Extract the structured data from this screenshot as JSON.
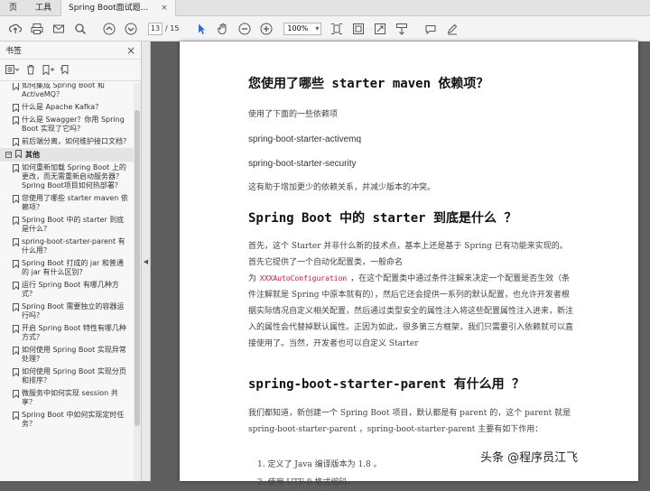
{
  "tabs": {
    "tools": "工具",
    "doc": "Spring Boot面试题...",
    "close": "×",
    "left_stub": "页"
  },
  "toolbar": {
    "page_current": "13",
    "page_total": "/ 15",
    "zoom": "100%"
  },
  "sidebar": {
    "title": "书签",
    "close": "×",
    "items_before": [
      {
        "label": "如何集成 Spring Boot 和 ActiveMQ？"
      },
      {
        "label": "什么是 Apache Kafka？"
      },
      {
        "label": "什么是 Swagger？你用 Spring Boot 实现了它吗？"
      },
      {
        "label": "前后端分离，如何维护接口文档？"
      }
    ],
    "group": {
      "label": "其他",
      "toggle": "−"
    },
    "items_after": [
      {
        "label": "如何重新加载 Spring Boot 上的更改，而无需重新启动服务器？Spring Boot项目如何热部署？"
      },
      {
        "label": "您使用了哪些 starter maven 依赖项？"
      },
      {
        "label": "Spring Boot 中的 starter 到底是什么？"
      },
      {
        "label": "spring-boot-starter-parent 有什么用？"
      },
      {
        "label": "Spring Boot 打成的 jar 和普通的 jar 有什么区别？"
      },
      {
        "label": "运行 Spring Boot 有哪几种方式？"
      },
      {
        "label": "Spring Boot 需要独立的容器运行吗？"
      },
      {
        "label": "开启 Spring Boot 特性有哪几种方式？"
      },
      {
        "label": "如何使用 Spring Boot 实现异常处理？"
      },
      {
        "label": "如何使用 Spring Boot 实现分页和排序？"
      },
      {
        "label": "微服务中如何实现 session 共享？"
      },
      {
        "label": "Spring Boot 中如何实现定时任务？"
      }
    ]
  },
  "doc": {
    "h1": "您使用了哪些 starter maven 依赖项？",
    "p1": "使用了下面的一些依赖项",
    "dep1": "spring-boot-starter-activemq",
    "dep2": "spring-boot-starter-security",
    "p2": "这有助于增加更少的依赖关系，并减少版本的冲突。",
    "h2": "Spring Boot 中的 starter 到底是什么 ？",
    "p3a": "首先，这个 Starter 并非什么新的技术点，基本上还是基于 Spring 已有功能来实现的。首先它提供了一个自动化配置类，一般命名",
    "p3b_pre": "为 ",
    "p3b_code": "XXXAutoConfiguration",
    "p3b_post": " ，在这个配置类中通过条件注解来决定一个配置是否生效（条件注解就是 Spring 中原本就有的），然后它还会提供一系列的默认配置，也允许开发者根据实际情况自定义相关配置，然后通过类型安全的属性注入将这些配置属性注入进来，新注入的属性会代替掉默认属性。正因为如此，很多第三方框架，我们只需要引入依赖就可以直接使用了。当然，开发者也可以自定义 Starter",
    "h3": "spring-boot-starter-parent 有什么用 ？",
    "p4": "我们都知道，新创建一个 Spring Boot 项目，默认都是有 parent 的，这个 parent 就是 spring-boot-starter-parent ，spring-boot-starter-parent 主要有如下作用：",
    "li1": "1.  定义了 Java 编译版本为 1.8 。",
    "li2": "2.  使用 UTF-8 格式编码。"
  },
  "watermark": "头条 @程序员江飞"
}
